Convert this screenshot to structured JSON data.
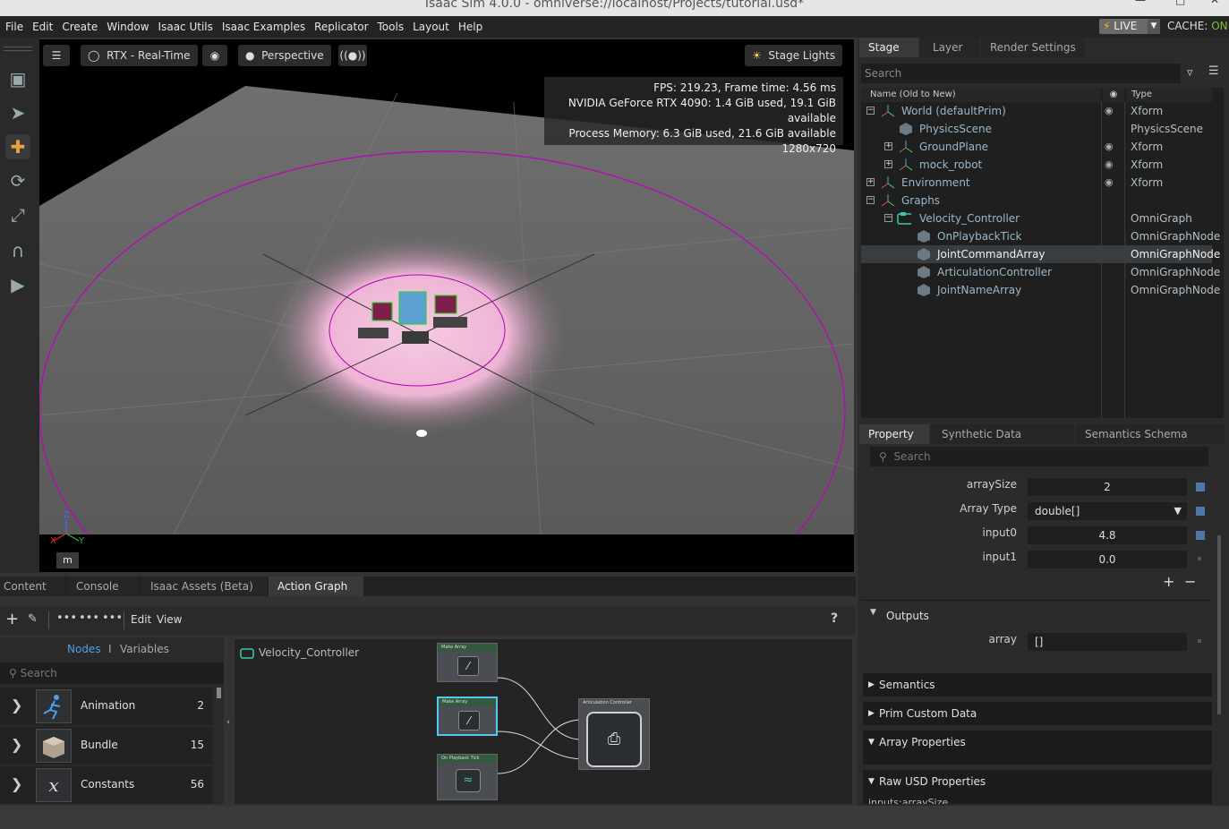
{
  "window": {
    "title": "Isaac Sim 4.0.0 - omniverse://localhost/Projects/tutorial.usd*"
  },
  "menu": [
    "File",
    "Edit",
    "Create",
    "Window",
    "Isaac Utils",
    "Isaac Examples",
    "Replicator",
    "Tools",
    "Layout",
    "Help"
  ],
  "status": {
    "live_label": "LIVE",
    "cache_label": "CACHE:",
    "cache_value": "ON",
    "accent": "#7ec32a"
  },
  "viewport": {
    "renderer": "RTX - Real-Time",
    "camera": "Perspective",
    "lights": "Stage Lights",
    "stats": [
      "FPS: 219.23, Frame time: 4.56 ms",
      "NVIDIA GeForce RTX 4090: 1.4 GiB used, 19.1 GiB available",
      "Process Memory: 6.3 GiB used, 21.6 GiB available",
      "1280x720"
    ],
    "units_button": "m",
    "axes": {
      "x": "X",
      "y": "Y",
      "z": "Z"
    }
  },
  "stage": {
    "tabs": [
      "Stage",
      "Layer",
      "Render Settings"
    ],
    "search_placeholder": "Search",
    "col_name": "Name (Old to New)",
    "col_type": "Type",
    "rows": [
      {
        "name": "World (defaultPrim)",
        "type": "Xform"
      },
      {
        "name": "PhysicsScene",
        "type": "PhysicsScene"
      },
      {
        "name": "GroundPlane",
        "type": "Xform"
      },
      {
        "name": "mock_robot",
        "type": "Xform"
      },
      {
        "name": "Environment",
        "type": "Xform"
      },
      {
        "name": "Graphs",
        "type": ""
      },
      {
        "name": "Velocity_Controller",
        "type": "OmniGraph"
      },
      {
        "name": "OnPlaybackTick",
        "type": "OmniGraphNode"
      },
      {
        "name": "JointCommandArray",
        "type": "OmniGraphNode"
      },
      {
        "name": "ArticulationController",
        "type": "OmniGraphNode"
      },
      {
        "name": "JointNameArray",
        "type": "OmniGraphNode"
      }
    ]
  },
  "property": {
    "tabs": [
      "Property",
      "Synthetic Data Recorder",
      "Semantics Schema Editor"
    ],
    "search_placeholder": "Search",
    "fields": {
      "arraySize_label": "arraySize",
      "arraySize": "2",
      "arrayType_label": "Array Type",
      "arrayType": "double[]",
      "input0_label": "input0",
      "input0": "4.8",
      "input1_label": "input1",
      "input1": "0.0"
    },
    "outputs_label": "Outputs",
    "array_label": "array",
    "array_value": "[]",
    "sections": [
      "Semantics",
      "Prim Custom Data",
      "Array Properties",
      "Raw USD Properties"
    ],
    "cut_label": "inputs:arraySize"
  },
  "bottom": {
    "tabs": [
      "Content",
      "Console",
      "Isaac Assets (Beta)",
      "Action Graph"
    ],
    "edit": "Edit",
    "view": "View",
    "help": "?",
    "nodes_tab": "Nodes",
    "sep": "I",
    "variables_tab": "Variables",
    "search_placeholder": "Search",
    "categories": [
      {
        "name": "Animation",
        "count": "2"
      },
      {
        "name": "Bundle",
        "count": "15"
      },
      {
        "name": "Constants",
        "count": "56"
      }
    ],
    "graph_name": "Velocity_Controller",
    "graph_nodes": [
      "Make Array",
      "Make Array",
      "On Playback Tick",
      "Articulation Controller"
    ]
  }
}
